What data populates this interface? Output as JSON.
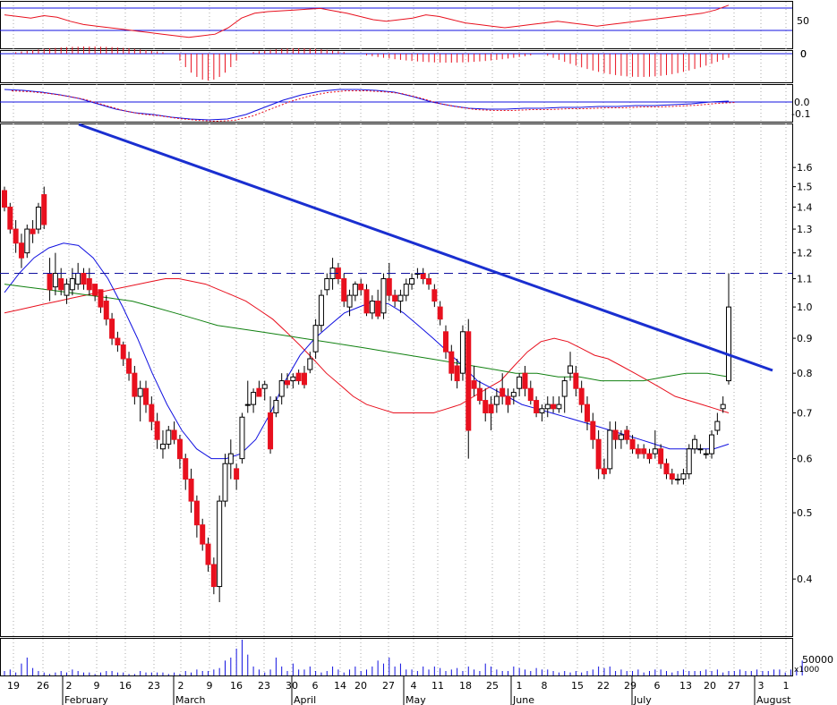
{
  "chart_data": {
    "type": "candlestick",
    "title": "",
    "price_axis": {
      "scale": "log",
      "range": [
        0.33,
        1.85
      ],
      "ticks": [
        "1.6",
        "1.5",
        "1.4",
        "1.3",
        "1.2",
        "1.1",
        "1.0",
        "0.9",
        "0.8",
        "0.7",
        "0.6",
        "0.5",
        "0.4"
      ],
      "tick_values": [
        1.6,
        1.5,
        1.4,
        1.3,
        1.2,
        1.1,
        1.0,
        0.9,
        0.8,
        0.7,
        0.6,
        0.5,
        0.4
      ],
      "resistance_level": 1.12
    },
    "date_axis": {
      "day_labels": [
        "19",
        "26",
        "2",
        "9",
        "16",
        "23",
        "2",
        "9",
        "16",
        "23",
        "30",
        "6",
        "14",
        "20",
        "27",
        "4",
        "11",
        "18",
        "25",
        "1",
        "8",
        "15",
        "22",
        "29",
        "6",
        "13",
        "20",
        "27",
        "3",
        "1"
      ],
      "month_labels": [
        "February",
        "March",
        "April",
        "May",
        "June",
        "July",
        "August"
      ]
    },
    "indicator_axes": {
      "rsi_ticks": [
        "50",
        "0"
      ],
      "macd_hist_tick": "0",
      "macd_ticks": [
        "0.0",
        "-0.1"
      ],
      "volume_tick": "50000",
      "volume_unit": "x1000"
    },
    "ohlc": [
      [
        1.48,
        1.5,
        1.38,
        1.4
      ],
      [
        1.4,
        1.42,
        1.28,
        1.3
      ],
      [
        1.3,
        1.34,
        1.2,
        1.24
      ],
      [
        1.24,
        1.28,
        1.14,
        1.18
      ],
      [
        1.2,
        1.32,
        1.18,
        1.3
      ],
      [
        1.3,
        1.34,
        1.24,
        1.28
      ],
      [
        1.3,
        1.42,
        1.28,
        1.4
      ],
      [
        1.46,
        1.5,
        1.3,
        1.32
      ],
      [
        1.12,
        1.18,
        1.02,
        1.06
      ],
      [
        1.07,
        1.2,
        1.04,
        1.12
      ],
      [
        1.1,
        1.14,
        1.04,
        1.06
      ],
      [
        1.04,
        1.1,
        1.01,
        1.08
      ],
      [
        1.06,
        1.14,
        1.04,
        1.1
      ],
      [
        1.08,
        1.16,
        1.06,
        1.12
      ],
      [
        1.12,
        1.14,
        1.06,
        1.08
      ],
      [
        1.1,
        1.14,
        1.04,
        1.06
      ],
      [
        1.08,
        1.08,
        1.02,
        1.04
      ],
      [
        1.06,
        1.06,
        0.98,
        1.0
      ],
      [
        1.02,
        1.04,
        0.94,
        0.96
      ],
      [
        0.96,
        0.98,
        0.88,
        0.9
      ],
      [
        0.9,
        0.92,
        0.86,
        0.88
      ],
      [
        0.88,
        0.89,
        0.82,
        0.84
      ],
      [
        0.84,
        0.86,
        0.78,
        0.8
      ],
      [
        0.8,
        0.82,
        0.72,
        0.74
      ],
      [
        0.74,
        0.78,
        0.68,
        0.76
      ],
      [
        0.76,
        0.78,
        0.7,
        0.72
      ],
      [
        0.72,
        0.74,
        0.66,
        0.68
      ],
      [
        0.68,
        0.7,
        0.62,
        0.64
      ],
      [
        0.62,
        0.66,
        0.6,
        0.63
      ],
      [
        0.63,
        0.67,
        0.62,
        0.66
      ],
      [
        0.66,
        0.68,
        0.63,
        0.64
      ],
      [
        0.64,
        0.65,
        0.58,
        0.6
      ],
      [
        0.6,
        0.61,
        0.54,
        0.56
      ],
      [
        0.56,
        0.58,
        0.5,
        0.52
      ],
      [
        0.52,
        0.53,
        0.46,
        0.48
      ],
      [
        0.48,
        0.49,
        0.44,
        0.45
      ],
      [
        0.45,
        0.46,
        0.41,
        0.42
      ],
      [
        0.42,
        0.43,
        0.38,
        0.39
      ],
      [
        0.39,
        0.53,
        0.37,
        0.52
      ],
      [
        0.52,
        0.61,
        0.51,
        0.59
      ],
      [
        0.59,
        0.64,
        0.56,
        0.61
      ],
      [
        0.58,
        0.59,
        0.54,
        0.56
      ],
      [
        0.6,
        0.7,
        0.59,
        0.69
      ],
      [
        0.72,
        0.78,
        0.7,
        0.72
      ],
      [
        0.72,
        0.76,
        0.7,
        0.75
      ],
      [
        0.76,
        0.78,
        0.74,
        0.74
      ],
      [
        0.76,
        0.78,
        0.73,
        0.77
      ],
      [
        0.7,
        0.74,
        0.61,
        0.62
      ],
      [
        0.7,
        0.74,
        0.69,
        0.73
      ],
      [
        0.74,
        0.8,
        0.72,
        0.78
      ],
      [
        0.78,
        0.8,
        0.76,
        0.77
      ],
      [
        0.78,
        0.8,
        0.76,
        0.79
      ],
      [
        0.8,
        0.81,
        0.77,
        0.78
      ],
      [
        0.8,
        0.82,
        0.76,
        0.77
      ],
      [
        0.81,
        0.86,
        0.8,
        0.84
      ],
      [
        0.86,
        0.96,
        0.84,
        0.94
      ],
      [
        0.94,
        1.06,
        0.92,
        1.04
      ],
      [
        1.06,
        1.12,
        1.04,
        1.1
      ],
      [
        1.1,
        1.18,
        1.06,
        1.14
      ],
      [
        1.14,
        1.16,
        1.08,
        1.1
      ],
      [
        1.1,
        1.12,
        1.0,
        1.02
      ],
      [
        1.0,
        1.06,
        0.97,
        1.04
      ],
      [
        1.04,
        1.09,
        1.02,
        1.08
      ],
      [
        1.08,
        1.1,
        1.04,
        1.06
      ],
      [
        1.06,
        1.08,
        0.97,
        0.98
      ],
      [
        0.98,
        1.04,
        0.96,
        1.02
      ],
      [
        1.02,
        1.06,
        0.96,
        0.97
      ],
      [
        0.98,
        1.12,
        0.96,
        1.1
      ],
      [
        1.1,
        1.16,
        1.02,
        1.04
      ],
      [
        1.04,
        1.06,
        1.0,
        1.02
      ],
      [
        1.02,
        1.06,
        0.98,
        1.04
      ],
      [
        1.04,
        1.1,
        1.02,
        1.08
      ],
      [
        1.08,
        1.12,
        1.06,
        1.1
      ],
      [
        1.12,
        1.14,
        1.1,
        1.12
      ],
      [
        1.12,
        1.14,
        1.08,
        1.1
      ],
      [
        1.1,
        1.12,
        1.06,
        1.08
      ],
      [
        1.06,
        1.08,
        1.0,
        1.02
      ],
      [
        1.0,
        1.02,
        0.94,
        0.96
      ],
      [
        0.92,
        0.94,
        0.84,
        0.86
      ],
      [
        0.86,
        0.88,
        0.78,
        0.8
      ],
      [
        0.82,
        0.84,
        0.76,
        0.78
      ],
      [
        0.8,
        0.94,
        0.78,
        0.92
      ],
      [
        0.92,
        0.96,
        0.6,
        0.66
      ],
      [
        0.78,
        0.82,
        0.74,
        0.76
      ],
      [
        0.76,
        0.78,
        0.72,
        0.73
      ],
      [
        0.73,
        0.76,
        0.68,
        0.7
      ],
      [
        0.72,
        0.74,
        0.66,
        0.7
      ],
      [
        0.72,
        0.76,
        0.7,
        0.74
      ],
      [
        0.76,
        0.8,
        0.72,
        0.74
      ],
      [
        0.74,
        0.76,
        0.7,
        0.72
      ],
      [
        0.74,
        0.76,
        0.72,
        0.75
      ],
      [
        0.76,
        0.8,
        0.74,
        0.79
      ],
      [
        0.8,
        0.82,
        0.74,
        0.76
      ],
      [
        0.76,
        0.78,
        0.72,
        0.73
      ],
      [
        0.73,
        0.74,
        0.69,
        0.7
      ],
      [
        0.7,
        0.72,
        0.68,
        0.71
      ],
      [
        0.71,
        0.74,
        0.69,
        0.72
      ],
      [
        0.72,
        0.74,
        0.7,
        0.71
      ],
      [
        0.71,
        0.74,
        0.7,
        0.72
      ],
      [
        0.74,
        0.79,
        0.7,
        0.78
      ],
      [
        0.8,
        0.86,
        0.78,
        0.82
      ],
      [
        0.8,
        0.82,
        0.74,
        0.76
      ],
      [
        0.76,
        0.78,
        0.7,
        0.72
      ],
      [
        0.72,
        0.74,
        0.66,
        0.68
      ],
      [
        0.68,
        0.7,
        0.62,
        0.64
      ],
      [
        0.64,
        0.66,
        0.56,
        0.58
      ],
      [
        0.58,
        0.6,
        0.56,
        0.57
      ],
      [
        0.58,
        0.68,
        0.57,
        0.66
      ],
      [
        0.66,
        0.68,
        0.62,
        0.64
      ],
      [
        0.64,
        0.66,
        0.62,
        0.65
      ],
      [
        0.66,
        0.67,
        0.63,
        0.64
      ],
      [
        0.64,
        0.65,
        0.61,
        0.62
      ],
      [
        0.62,
        0.63,
        0.6,
        0.61
      ],
      [
        0.62,
        0.63,
        0.6,
        0.61
      ],
      [
        0.61,
        0.62,
        0.59,
        0.6
      ],
      [
        0.61,
        0.66,
        0.6,
        0.62
      ],
      [
        0.62,
        0.63,
        0.58,
        0.59
      ],
      [
        0.59,
        0.6,
        0.56,
        0.57
      ],
      [
        0.57,
        0.58,
        0.55,
        0.56
      ],
      [
        0.56,
        0.57,
        0.55,
        0.56
      ],
      [
        0.56,
        0.58,
        0.55,
        0.57
      ],
      [
        0.57,
        0.63,
        0.56,
        0.62
      ],
      [
        0.62,
        0.65,
        0.61,
        0.64
      ],
      [
        0.62,
        0.63,
        0.61,
        0.62
      ],
      [
        0.61,
        0.62,
        0.6,
        0.61
      ],
      [
        0.61,
        0.66,
        0.6,
        0.65
      ],
      [
        0.66,
        0.7,
        0.65,
        0.68
      ],
      [
        0.71,
        0.74,
        0.7,
        0.72
      ],
      [
        0.78,
        1.12,
        0.77,
        1.0
      ]
    ],
    "volume": [
      3,
      4,
      2,
      8,
      12,
      5,
      3,
      2,
      1,
      2,
      3,
      2,
      4,
      3,
      2,
      2,
      1,
      2,
      3,
      3,
      2,
      2,
      1,
      1,
      3,
      2,
      2,
      2,
      2,
      1,
      2,
      1,
      3,
      2,
      4,
      3,
      3,
      4,
      5,
      10,
      12,
      18,
      24,
      14,
      6,
      4,
      2,
      4,
      12,
      6,
      3,
      8,
      4,
      4,
      6,
      3,
      2,
      3,
      6,
      4,
      2,
      4,
      6,
      3,
      4,
      6,
      10,
      8,
      12,
      6,
      8,
      4,
      4,
      3,
      6,
      4,
      6,
      5,
      3,
      4,
      5,
      3,
      6,
      4,
      3,
      8,
      6,
      4,
      3,
      3,
      6,
      5,
      4,
      3,
      5,
      4,
      4,
      3,
      2,
      3,
      2,
      3,
      2,
      3,
      4,
      6,
      5,
      6,
      3,
      4,
      3,
      3,
      4,
      2,
      3,
      4,
      4,
      3,
      2,
      3,
      4,
      3,
      3,
      3,
      4,
      3,
      4,
      2,
      3,
      3,
      4,
      3,
      3,
      4,
      3,
      3,
      4,
      4,
      2,
      4,
      4,
      10
    ],
    "indicators": {
      "ma_red": [
        0.98,
        0.99,
        1.0,
        1.01,
        1.02,
        1.03,
        1.04,
        1.05,
        1.06,
        1.07,
        1.08,
        1.09,
        1.1,
        1.1,
        1.09,
        1.08,
        1.06,
        1.04,
        1.02,
        0.99,
        0.96,
        0.92,
        0.88,
        0.84,
        0.8,
        0.77,
        0.74,
        0.72,
        0.71,
        0.7,
        0.7,
        0.7,
        0.7,
        0.71,
        0.72,
        0.74,
        0.76,
        0.78,
        0.82,
        0.86,
        0.89,
        0.9,
        0.89,
        0.87,
        0.85,
        0.84,
        0.82,
        0.8,
        0.78,
        0.76,
        0.74,
        0.73,
        0.72,
        0.71,
        0.7
      ],
      "ma_blue": [
        1.05,
        1.12,
        1.18,
        1.22,
        1.24,
        1.23,
        1.18,
        1.1,
        1.0,
        0.9,
        0.8,
        0.72,
        0.66,
        0.62,
        0.6,
        0.6,
        0.61,
        0.64,
        0.7,
        0.78,
        0.85,
        0.9,
        0.94,
        0.98,
        1.0,
        1.02,
        1.01,
        0.98,
        0.94,
        0.9,
        0.86,
        0.82,
        0.78,
        0.76,
        0.74,
        0.72,
        0.71,
        0.7,
        0.69,
        0.68,
        0.67,
        0.66,
        0.65,
        0.64,
        0.63,
        0.62,
        0.62,
        0.62,
        0.62,
        0.63
      ],
      "ma_green": [
        1.08,
        1.07,
        1.06,
        1.05,
        1.04,
        1.03,
        1.02,
        1.0,
        0.98,
        0.96,
        0.94,
        0.93,
        0.92,
        0.91,
        0.9,
        0.89,
        0.88,
        0.87,
        0.86,
        0.85,
        0.84,
        0.83,
        0.82,
        0.81,
        0.8,
        0.8,
        0.79,
        0.79,
        0.78,
        0.78,
        0.78,
        0.79,
        0.8,
        0.8,
        0.79
      ]
    }
  }
}
